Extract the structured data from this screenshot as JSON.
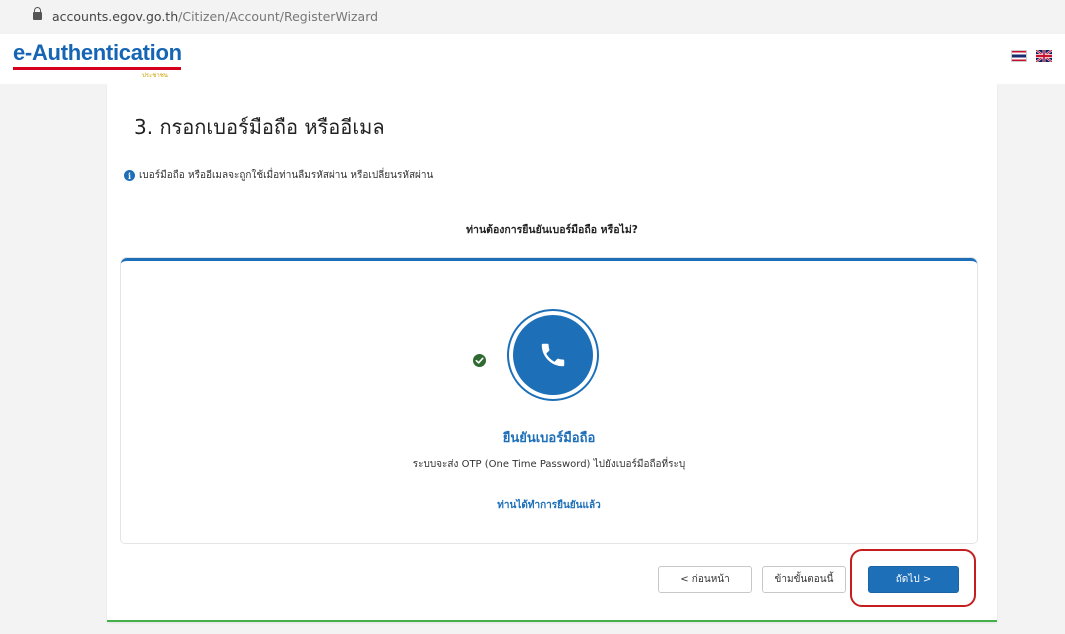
{
  "browser": {
    "url_host": "accounts.egov.go.th",
    "url_path": "/Citizen/Account/RegisterWizard"
  },
  "header": {
    "logo_text": "e-Authentication",
    "logo_subtext": "ประชาชน",
    "languages": [
      "th-flag-icon",
      "uk-flag-icon"
    ]
  },
  "wizard": {
    "step_title": "3. กรอกเบอร์มือถือ หรืออีเมล",
    "info_text": "เบอร์มือถือ หรืออีเมลจะถูกใช้เมื่อท่านลืมรหัสผ่าน หรือเปลี่ยนรหัสผ่าน",
    "question": "ท่านต้องการยืนยันเบอร์มือถือ หรือไม่?"
  },
  "option": {
    "icon": "phone-icon",
    "title": "ยืนยันเบอร์มือถือ",
    "description": "ระบบจะส่ง OTP (One Time Password) ไปยังเบอร์มือถือที่ระบุ",
    "verified_text": "ท่านได้ทำการยืนยันแล้ว"
  },
  "buttons": {
    "prev": "< ก่อนหน้า",
    "skip": "ข้ามขั้นตอนนี้",
    "next": "ถัดไป >"
  },
  "colors": {
    "brand_blue": "#1d6fb8",
    "check_green": "#2f6a33",
    "highlight_red": "#c41e1e",
    "card_bottom_green": "#44b04a"
  }
}
